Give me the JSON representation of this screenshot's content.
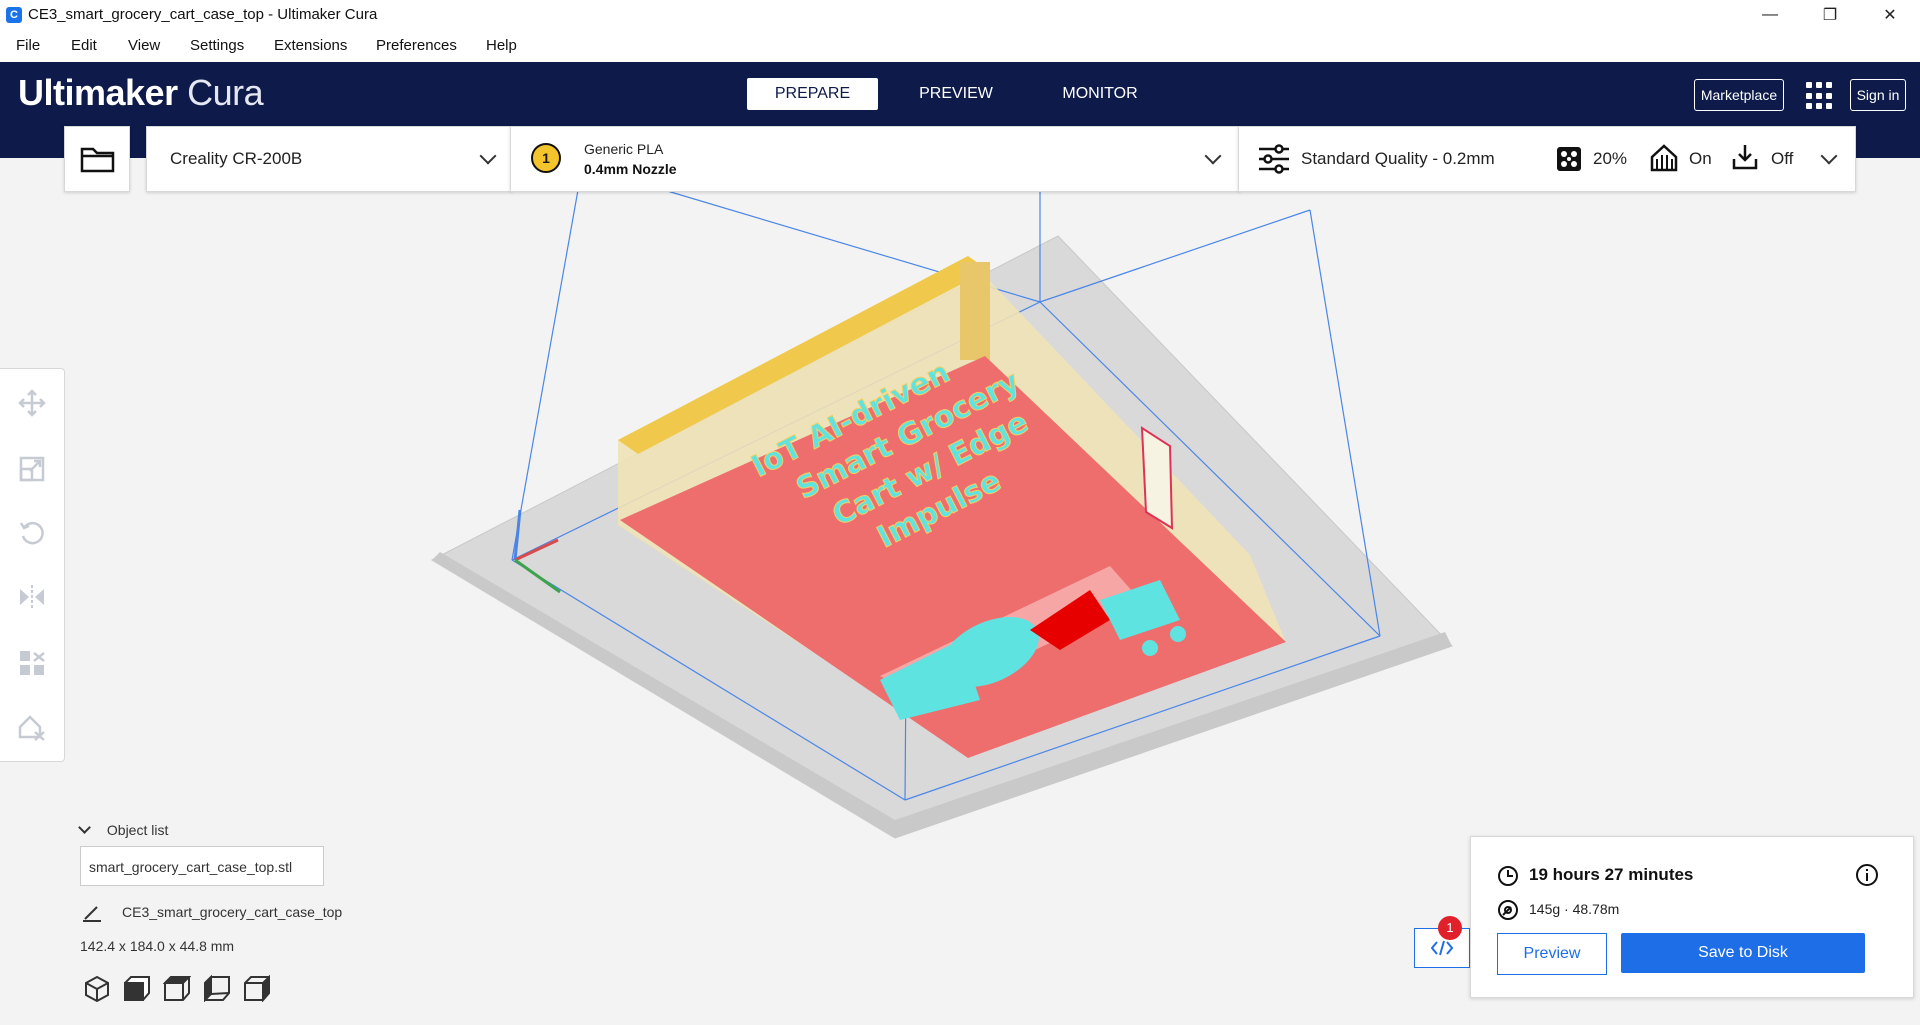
{
  "window": {
    "title": "CE3_smart_grocery_cart_case_top - Ultimaker Cura",
    "app_icon": "C",
    "minimize": "—",
    "restore": "❐",
    "close": "✕"
  },
  "menu": [
    "File",
    "Edit",
    "View",
    "Settings",
    "Extensions",
    "Preferences",
    "Help"
  ],
  "header": {
    "logo_brand": "Ultimaker",
    "logo_product": "Cura",
    "stages": [
      {
        "label": "PREPARE",
        "active": true
      },
      {
        "label": "PREVIEW",
        "active": false
      },
      {
        "label": "MONITOR",
        "active": false
      }
    ],
    "marketplace": "Marketplace",
    "sign_in": "Sign in"
  },
  "toolbar": {
    "printer": "Creality CR-200B",
    "extruder_number": "1",
    "material": "Generic PLA",
    "nozzle": "0.4mm Nozzle",
    "quality": "Standard Quality - 0.2mm",
    "infill": "20%",
    "support": "On",
    "adhesion": "Off"
  },
  "object_list": {
    "header": "Object list",
    "file": "smart_grocery_cart_case_top.stl",
    "name": "CE3_smart_grocery_cart_case_top",
    "dimensions": "142.4 x 184.0 x 44.8 mm"
  },
  "print": {
    "time": "19 hours 27 minutes",
    "material": "145g · 48.78m",
    "preview_label": "Preview",
    "save_label": "Save to Disk",
    "badge_count": "1"
  },
  "model": {
    "embossed_text": [
      "IoT AI-driven",
      "Smart Grocery",
      "Cart w/ Edge",
      "Impulse"
    ]
  },
  "colors": {
    "header_bg": "#0d1a4a",
    "accent": "#1e6ee8",
    "overhang": "#ee6e6e",
    "model_yellow": "#f2cf64",
    "model_cyan": "#5fe3e0"
  }
}
